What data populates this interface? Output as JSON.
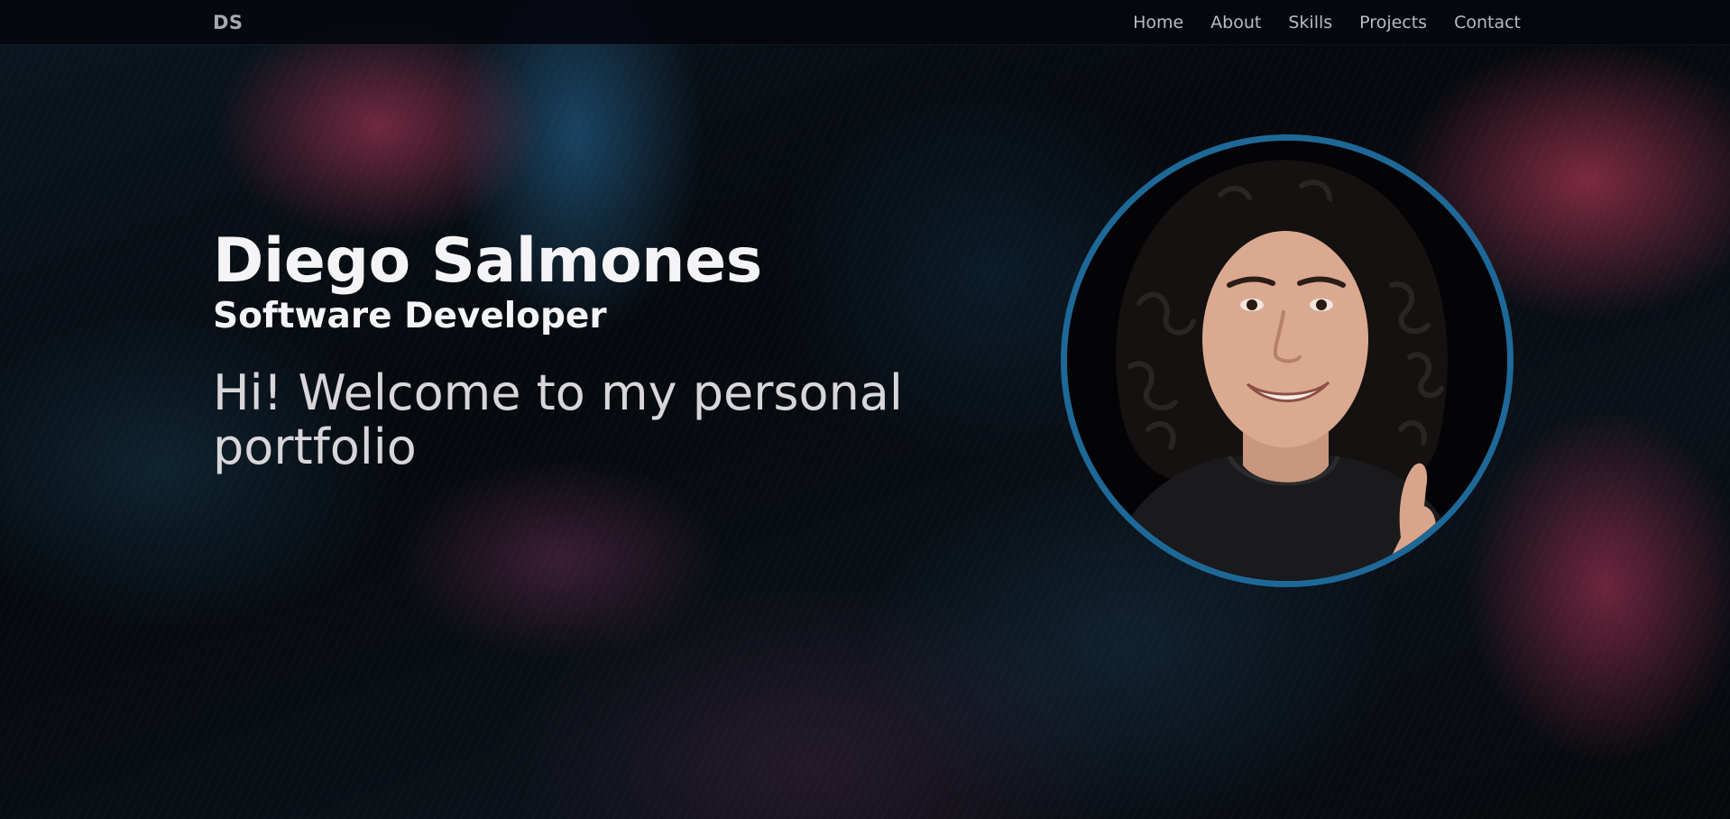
{
  "navbar": {
    "logo": "DS",
    "links": [
      "Home",
      "About",
      "Skills",
      "Projects",
      "Contact"
    ]
  },
  "hero": {
    "name": "Diego Salmones",
    "role": "Software Developer",
    "welcome": "Hi! Welcome to my personal portfolio"
  },
  "colors": {
    "accent_ring": "#1e6897",
    "background": "#050608",
    "text_primary": "#f4f4f6"
  }
}
